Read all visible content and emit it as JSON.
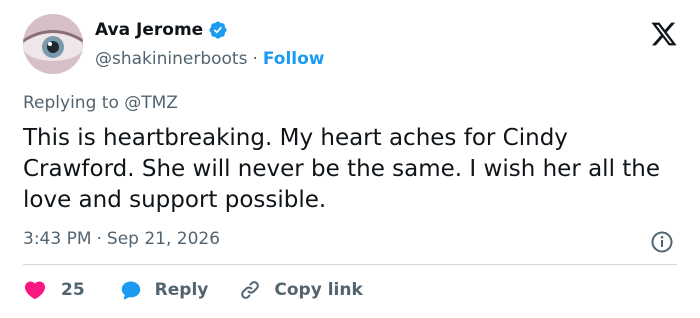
{
  "author": {
    "display_name": "Ava Jerome",
    "handle": "@shakininerboots",
    "separator": "·",
    "follow_label": "Follow",
    "avatar": "eye-closeup-avatar",
    "verified_icon": "verified-badge-icon"
  },
  "reply_context": {
    "prefix": "Replying to ",
    "mention": "@TMZ"
  },
  "tweet": {
    "text": "This is heartbreaking. My heart aches for Cindy Crawford. She will never be the same. I wish her all the love and support possible.",
    "time": "3:43 PM",
    "separator": "·",
    "date": "Sep 21, 2026"
  },
  "actions": {
    "like_count": "25",
    "reply_label": "Reply",
    "copy_link_label": "Copy link"
  },
  "colors": {
    "accent": "#1d9bf0",
    "heart": "#f91880",
    "text": "#0f1419",
    "muted": "#536471",
    "divider": "#cfd9de"
  }
}
